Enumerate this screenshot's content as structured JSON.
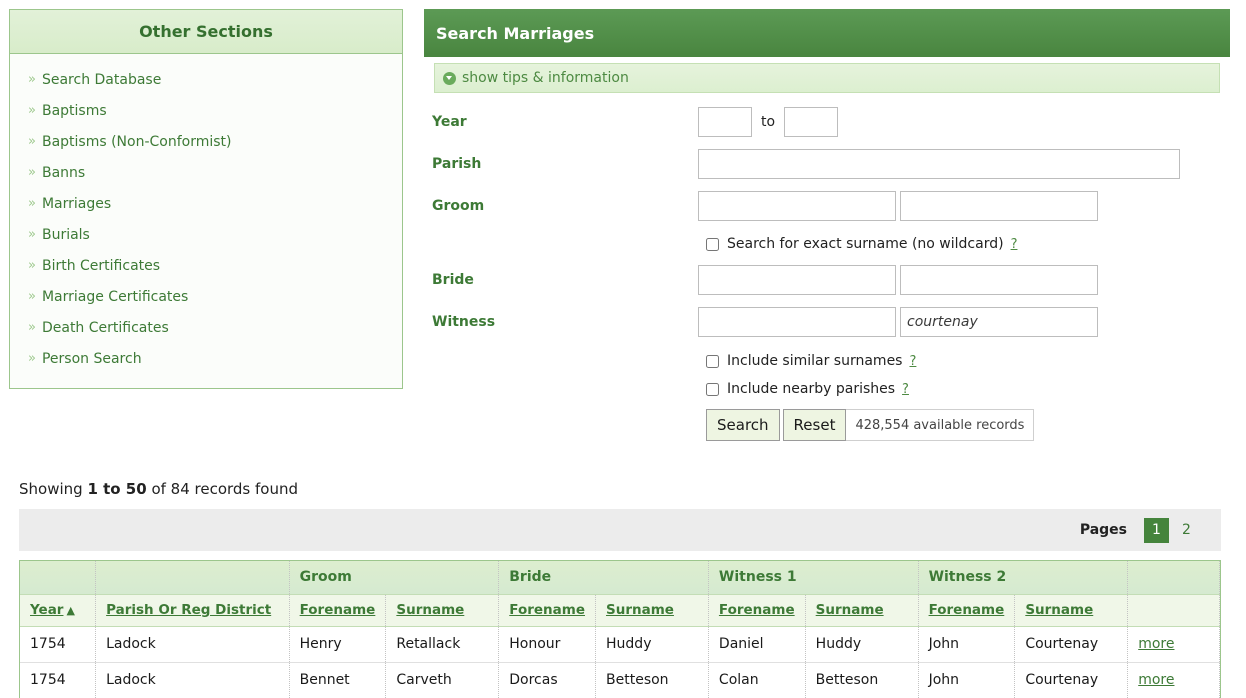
{
  "sidebar": {
    "title": "Other Sections",
    "arrow_glyph": "»",
    "items": [
      {
        "label": "Search Database"
      },
      {
        "label": "Baptisms"
      },
      {
        "label": "Baptisms (Non-Conformist)"
      },
      {
        "label": "Banns"
      },
      {
        "label": "Marriages"
      },
      {
        "label": "Burials"
      },
      {
        "label": "Birth Certificates"
      },
      {
        "label": "Marriage Certificates"
      },
      {
        "label": "Death Certificates"
      },
      {
        "label": "Person Search"
      }
    ]
  },
  "panel": {
    "title": "Search Marriages",
    "tips_label": "show tips & information",
    "labels": {
      "year": "Year",
      "parish": "Parish",
      "groom": "Groom",
      "bride": "Bride",
      "witness": "Witness",
      "to": "to"
    },
    "values": {
      "year_from": "",
      "year_to": "",
      "parish": "",
      "groom_forename": "",
      "groom_surname": "",
      "bride_forename": "",
      "bride_surname": "",
      "witness_forename": "",
      "witness_surname": "courtenay"
    },
    "checkboxes": {
      "exact_surname": "Search for exact surname (no wildcard)",
      "similar_surnames": "Include similar surnames",
      "nearby_parishes": "Include nearby parishes"
    },
    "help_glyph": "?",
    "buttons": {
      "search": "Search",
      "reset": "Reset"
    },
    "available_records": "428,554 available records"
  },
  "results": {
    "showing_prefix": "Showing ",
    "showing_range": "1 to 50",
    "showing_suffix": " of 84 records found",
    "pages_label": "Pages",
    "pages": [
      "1",
      "2"
    ],
    "active_page": "1",
    "group_headers": [
      "",
      "",
      "Groom",
      "Bride",
      "Witness 1",
      "Witness 2",
      ""
    ],
    "columns": [
      {
        "label": "Year",
        "sorted": "asc",
        "arrow": "▲"
      },
      {
        "label": "Parish Or Reg District"
      },
      {
        "label": "Forename"
      },
      {
        "label": "Surname"
      },
      {
        "label": "Forename"
      },
      {
        "label": "Surname"
      },
      {
        "label": "Forename"
      },
      {
        "label": "Surname"
      },
      {
        "label": "Forename"
      },
      {
        "label": "Surname"
      },
      {
        "label": ""
      }
    ],
    "more_label": "more",
    "rows": [
      {
        "year": "1754",
        "parish": "Ladock",
        "groom_forename": "Henry",
        "groom_surname": "Retallack",
        "bride_forename": "Honour",
        "bride_surname": "Huddy",
        "w1_forename": "Daniel",
        "w1_surname": "Huddy",
        "w2_forename": "John",
        "w2_surname": "Courtenay"
      },
      {
        "year": "1754",
        "parish": "Ladock",
        "groom_forename": "Bennet",
        "groom_surname": "Carveth",
        "bride_forename": "Dorcas",
        "bride_surname": "Betteson",
        "w1_forename": "Colan",
        "w1_surname": "Betteson",
        "w2_forename": "John",
        "w2_surname": "Courtenay"
      }
    ]
  },
  "colors": {
    "header_green": "#49853f",
    "accent_green": "#3d7a36",
    "panel_border": "#9cc68c",
    "page_active": "#45843c"
  }
}
